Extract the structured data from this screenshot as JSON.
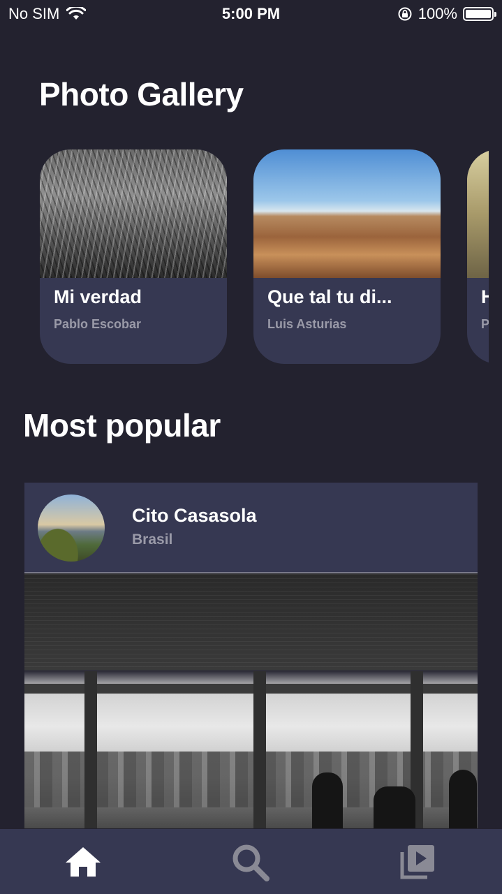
{
  "status_bar": {
    "carrier": "No SIM",
    "time": "5:00 PM",
    "battery": "100%",
    "battery_level": 1.0
  },
  "sections": {
    "gallery_title": "Photo Gallery",
    "popular_title": "Most popular"
  },
  "gallery": [
    {
      "title": "Mi verdad",
      "author": "Pablo Escobar"
    },
    {
      "title": "Que tal tu di...",
      "author": "Luis Asturias"
    },
    {
      "title": "H",
      "author": "P"
    }
  ],
  "popular_post": {
    "name": "Cito Casasola",
    "location": "Brasil"
  },
  "tab_bar": {
    "items": [
      {
        "icon": "home-icon",
        "active": true
      },
      {
        "icon": "search-icon",
        "active": false
      },
      {
        "icon": "video-library-icon",
        "active": false
      }
    ]
  },
  "colors": {
    "background": "#23222f",
    "card": "#363852",
    "subtext": "#9a9aa8",
    "inactive_icon": "#8a8a95"
  }
}
